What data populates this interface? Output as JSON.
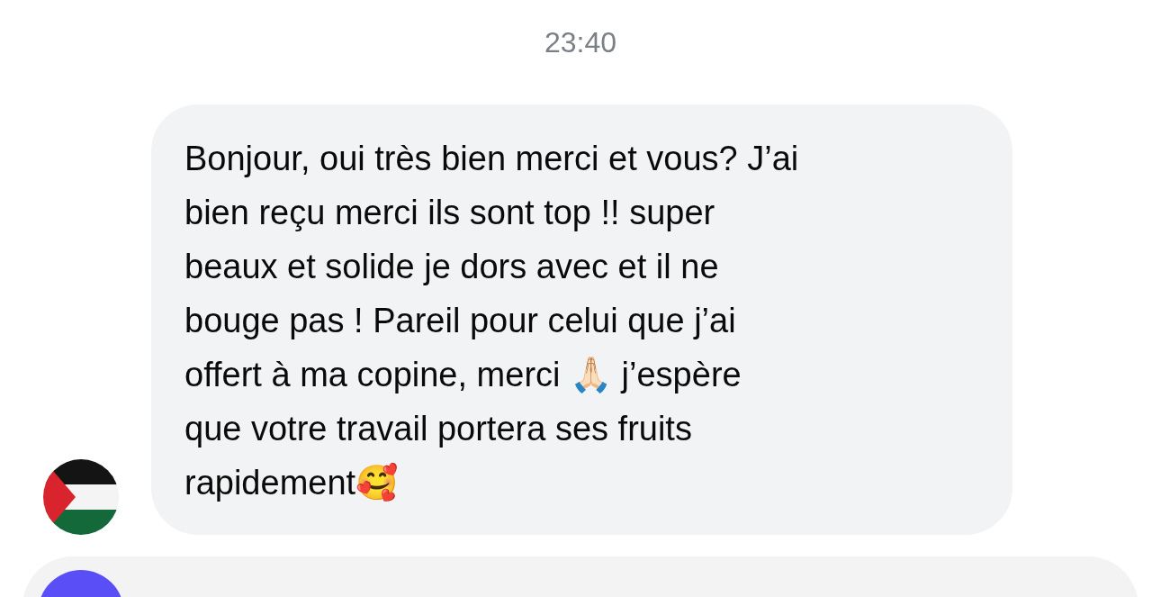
{
  "timestamp": "23:40",
  "messages": [
    {
      "text": "Bonjour, oui très bien merci et vous? J’ai\nbien reçu merci ils sont top !! super\nbeaux et solide je dors avec et il ne\nbouge pas ! Pareil pour celui que j’ai\noffert à ma copine, merci 🙏🏻 j’espère\nque votre travail portera ses fruits\nrapidement🥰"
    }
  ]
}
